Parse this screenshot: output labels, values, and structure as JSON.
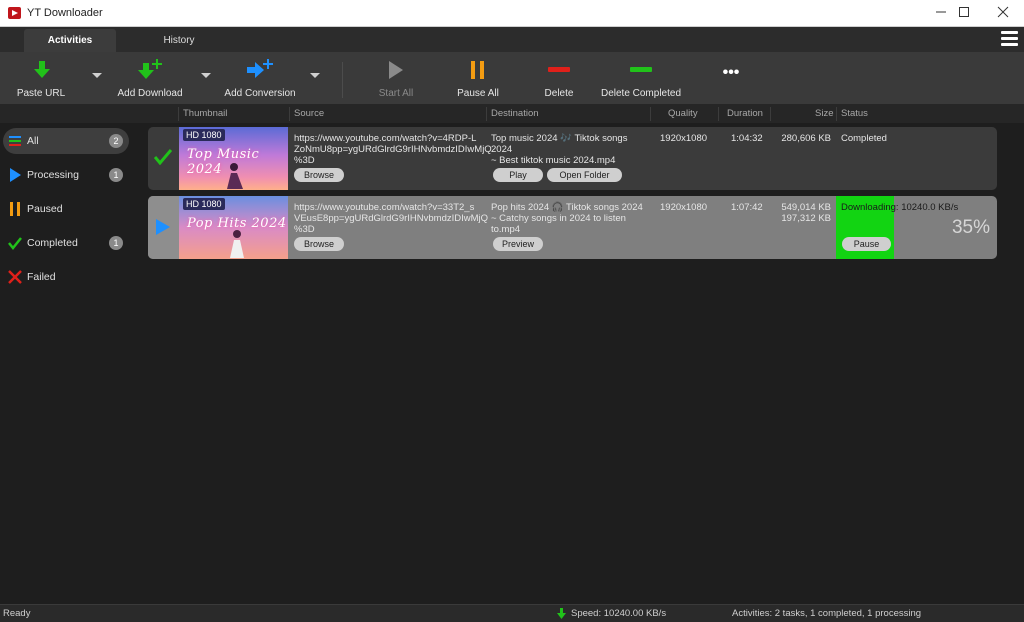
{
  "window": {
    "title": "YT Downloader"
  },
  "tabs": [
    {
      "label": "Activities",
      "active": true
    },
    {
      "label": "History",
      "active": false
    }
  ],
  "toolbar": {
    "paste_url": "Paste URL",
    "add_download": "Add Download",
    "add_conversion": "Add Conversion",
    "start_all": "Start All",
    "pause_all": "Pause All",
    "delete": "Delete",
    "delete_completed": "Delete Completed",
    "more": "•••"
  },
  "columns": {
    "thumbnail": "Thumbnail",
    "source": "Source",
    "destination": "Destination",
    "quality": "Quality",
    "duration": "Duration",
    "size": "Size",
    "status": "Status"
  },
  "sidebar": {
    "items": [
      {
        "label": "All",
        "count": "2",
        "icon": "list-icon"
      },
      {
        "label": "Processing",
        "count": "1",
        "icon": "play-icon"
      },
      {
        "label": "Paused",
        "count": "",
        "icon": "pause-icon"
      },
      {
        "label": "Completed",
        "count": "1",
        "icon": "check-icon"
      },
      {
        "label": "Failed",
        "count": "",
        "icon": "cross-icon"
      }
    ]
  },
  "rows": [
    {
      "state": "completed",
      "hd": "HD 1080",
      "thumb_title": "Top Music 2024",
      "source": [
        "https://www.youtube.com/watch?v=4RDP-L",
        "ZoNmU8pp=ygURdGlrdG9rIHNvbmdzIDIwMjQ",
        "%3D"
      ],
      "browse": "Browse",
      "destination": [
        "Top music 2024 🎶 Tiktok songs 2024",
        "~ Best tiktok music 2024.mp4"
      ],
      "play": "Play",
      "open_folder": "Open Folder",
      "quality": "1920x1080",
      "duration": "1:04:32",
      "size": "280,606 KB",
      "status": "Completed"
    },
    {
      "state": "downloading",
      "hd": "HD 1080",
      "thumb_title": "Pop Hits 2024",
      "source": [
        "https://www.youtube.com/watch?v=33T2_s",
        "VEusE8pp=ygURdGlrdG9rIHNvbmdzIDIwMjQ",
        "%3D"
      ],
      "browse": "Browse",
      "destination": [
        "Pop hits 2024 🎧 Tiktok songs 2024",
        "~ Catchy songs in 2024 to listen",
        "to.mp4"
      ],
      "preview": "Preview",
      "quality": "1920x1080",
      "duration": "1:07:42",
      "size": "549,014 KB",
      "size2": "197,312 KB",
      "status": "Downloading: 10240.0 KB/s",
      "pause": "Pause",
      "percent": "35%"
    }
  ],
  "statusbar": {
    "ready": "Ready",
    "speed": "Speed: 10240.00 KB/s",
    "activities": "Activities: 2 tasks, 1 completed, 1 processing"
  },
  "colors": {
    "green": "#21c21a",
    "blue": "#1e90ff",
    "orange": "#f39c12",
    "red": "#e0201a"
  }
}
